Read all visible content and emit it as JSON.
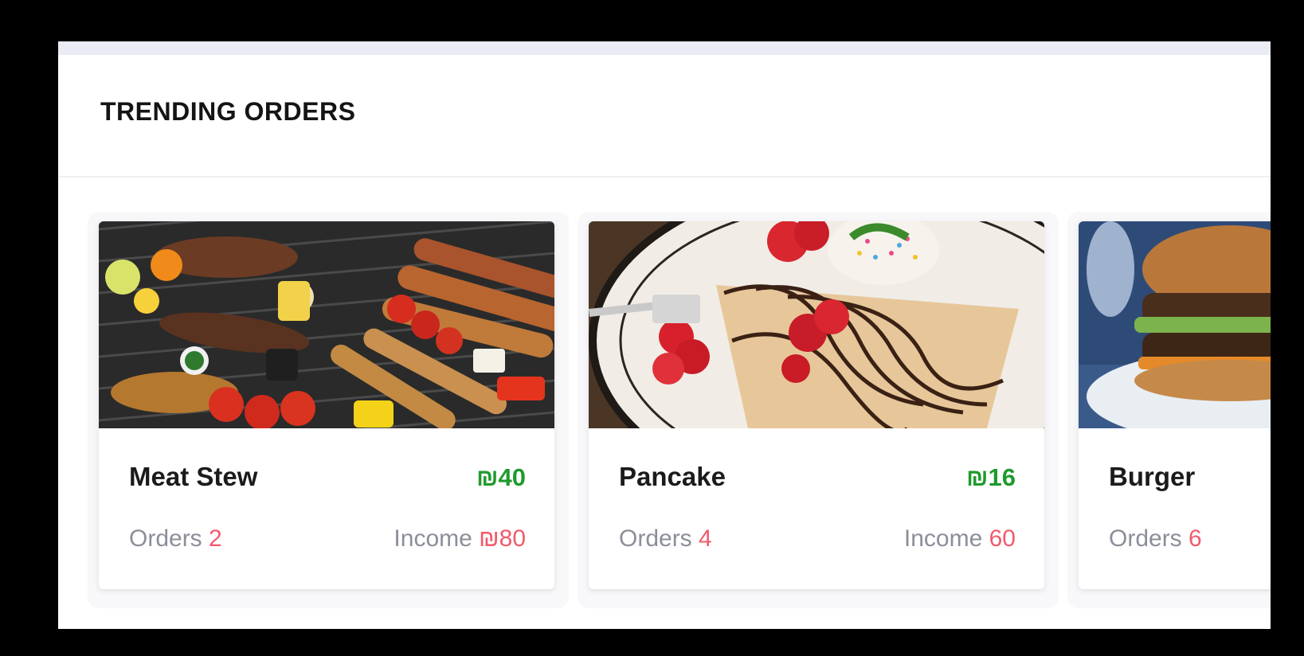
{
  "section": {
    "title": "TRENDING ORDERS"
  },
  "labels": {
    "orders": "Orders",
    "income": "Income"
  },
  "colors": {
    "price": "#1f9a2c",
    "accent": "#f25a6b",
    "muted": "#8c8f99"
  },
  "items": [
    {
      "name": "Meat Stew",
      "price": "₪40",
      "orders": "2",
      "income": "₪80",
      "image": "grilled-meat-and-vegetables-photo"
    },
    {
      "name": "Pancake",
      "price": "₪16",
      "orders": "4",
      "income": "60",
      "image": "crepe-with-strawberries-photo"
    },
    {
      "name": "Burger",
      "orders": "6",
      "image": "burger-photo"
    }
  ]
}
